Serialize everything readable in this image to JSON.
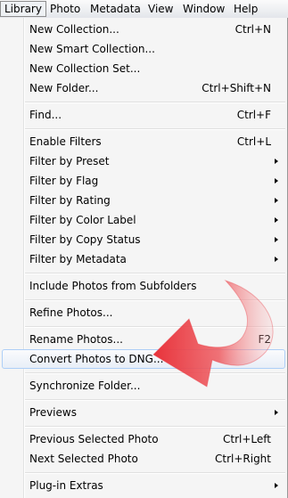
{
  "menubar": {
    "items": [
      {
        "label": "Library"
      },
      {
        "label": "Photo"
      },
      {
        "label": "Metadata"
      },
      {
        "label": "View"
      },
      {
        "label": "Window"
      },
      {
        "label": "Help"
      }
    ]
  },
  "menu": {
    "items": [
      {
        "label": "New Collection...",
        "shortcut": "Ctrl+N"
      },
      {
        "label": "New Smart Collection...",
        "shortcut": ""
      },
      {
        "label": "New Collection Set...",
        "shortcut": ""
      },
      {
        "label": "New Folder...",
        "shortcut": "Ctrl+Shift+N"
      },
      {
        "label": "Find...",
        "shortcut": "Ctrl+F"
      },
      {
        "label": "Enable Filters",
        "shortcut": "Ctrl+L"
      },
      {
        "label": "Filter by Preset",
        "shortcut": ""
      },
      {
        "label": "Filter by Flag",
        "shortcut": ""
      },
      {
        "label": "Filter by Rating",
        "shortcut": ""
      },
      {
        "label": "Filter by Color Label",
        "shortcut": ""
      },
      {
        "label": "Filter by Copy Status",
        "shortcut": ""
      },
      {
        "label": "Filter by Metadata",
        "shortcut": ""
      },
      {
        "label": "Include Photos from Subfolders",
        "shortcut": ""
      },
      {
        "label": "Refine Photos...",
        "shortcut": ""
      },
      {
        "label": "Rename Photos...",
        "shortcut": "F2"
      },
      {
        "label": "Convert Photos to DNG...",
        "shortcut": ""
      },
      {
        "label": "Synchronize Folder...",
        "shortcut": ""
      },
      {
        "label": "Previews",
        "shortcut": ""
      },
      {
        "label": "Previous Selected Photo",
        "shortcut": "Ctrl+Left"
      },
      {
        "label": "Next Selected Photo",
        "shortcut": "Ctrl+Right"
      },
      {
        "label": "Plug-in Extras",
        "shortcut": ""
      }
    ]
  },
  "highlighted_item": "Convert Photos to DNG...",
  "colors": {
    "menu_background": "#f5f5f5",
    "highlight_border": "#aecff7",
    "annotation_arrow": "#e8323a"
  }
}
